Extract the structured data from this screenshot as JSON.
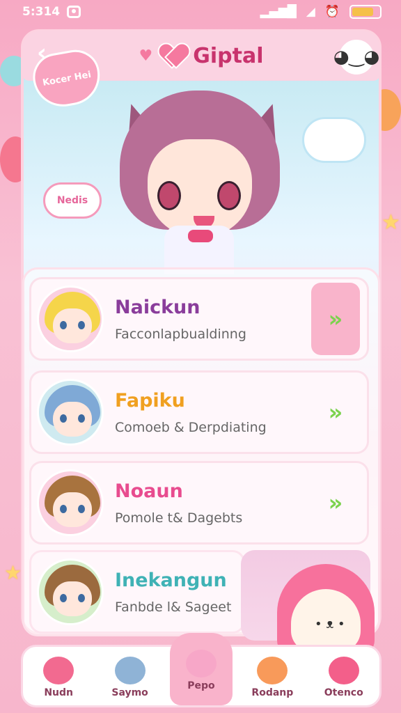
{
  "status_bar": {
    "time": "5:314",
    "icons": [
      "camera-icon",
      "signal-icon",
      "signal-triangle-icon",
      "alarm-icon",
      "battery-icon"
    ],
    "battery_level": 0.8
  },
  "header": {
    "back_icon": "chevron-left-icon",
    "title": "Giptal",
    "title_icon": "heart-icon",
    "profile_icon": "smiley-face-icon"
  },
  "decor": {
    "heart_badge_text": "Kocer Hei",
    "cloud_badge_text": "Nedis"
  },
  "list": {
    "items": [
      {
        "name": "Naickun",
        "desc": "Facconlapbualdinng",
        "name_color": "#8a3d9b",
        "hair": "#f5d54a",
        "bg": "#fbd0e0",
        "chevron_filled": true
      },
      {
        "name": "Fapiku",
        "desc": "Comoeb & Derpdiating",
        "name_color": "#f0a020",
        "hair": "#7fa9d6",
        "bg": "#cfeaf0",
        "chevron_filled": false
      },
      {
        "name": "Noaun",
        "desc": "Pomole t& Dagebts",
        "name_color": "#e84c8f",
        "hair": "#a8733e",
        "bg": "#fbd0e0",
        "chevron_filled": false
      },
      {
        "name": "Inekangun",
        "desc": "Fanbde l& Sageet",
        "name_color": "#3fb2b5",
        "hair": "#9b6a3e",
        "bg": "#d6eecb",
        "chevron_filled": false
      }
    ]
  },
  "bottom_nav": {
    "items": [
      {
        "label": "Nudn",
        "icon": "mushroom-icon",
        "color": "#f26a90",
        "active": false
      },
      {
        "label": "Saymo",
        "icon": "character-icon",
        "color": "#8fb3d6",
        "active": false
      },
      {
        "label": "Pepo",
        "icon": "bear-face-icon",
        "color": "#f7a7c8",
        "active": true
      },
      {
        "label": "Rodanp",
        "icon": "blob-face-icon",
        "color": "#f89a5a",
        "active": false
      },
      {
        "label": "Otenco",
        "icon": "toy-blocks-icon",
        "color": "#f35f8a",
        "active": false
      }
    ]
  }
}
